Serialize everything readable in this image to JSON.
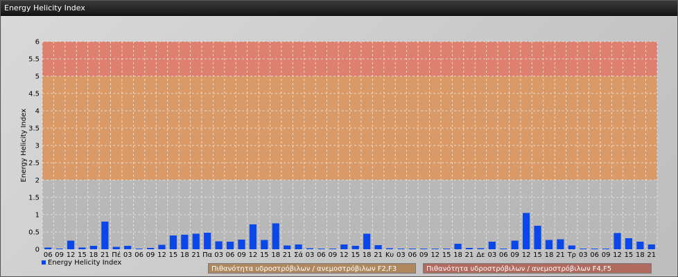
{
  "window": {
    "title": "Energy Helicity Index"
  },
  "legend": {
    "series_label": "Energy Helicity Index",
    "band1_label": "Πιθανότητα υδροστρόβιλων / ανεμοστρόβιλων F2,F3",
    "band2_label": "Πιθανότητα υδροστρόβιλων / ανεμοστρόβιλων F4,F5"
  },
  "colors": {
    "bar": "#0a47e6",
    "band_low": "#b8b8b8",
    "band_mid": "#d99a68",
    "band_high": "#de8070",
    "band1_legend": "#b08860",
    "band2_legend": "#b06a5e"
  },
  "chart_data": {
    "type": "bar",
    "ylabel": "Energy Helicity Index",
    "ylim": [
      0,
      6
    ],
    "yticks": [
      "0",
      "0.5",
      "1",
      "1.5",
      "2",
      "2.5",
      "3",
      "3.5",
      "4",
      "4.5",
      "5",
      "5.5",
      "6"
    ],
    "bands": [
      {
        "from": 0,
        "to": 2,
        "color": "#b8b8b8"
      },
      {
        "from": 2,
        "to": 5,
        "color": "#d99a68"
      },
      {
        "from": 5,
        "to": 6,
        "color": "#de8070"
      }
    ],
    "grid": true,
    "legend_position": "bottom-left",
    "categories": [
      "06",
      "09",
      "12",
      "15",
      "18",
      "21",
      "Πέ",
      "03",
      "06",
      "09",
      "12",
      "15",
      "18",
      "21",
      "Πα",
      "03",
      "06",
      "09",
      "12",
      "15",
      "18",
      "21",
      "Σά",
      "03",
      "06",
      "09",
      "12",
      "15",
      "18",
      "21",
      "Κυ",
      "03",
      "06",
      "09",
      "12",
      "15",
      "18",
      "21",
      "Δε",
      "03",
      "06",
      "09",
      "12",
      "15",
      "18",
      "21",
      "Τρ",
      "03",
      "06",
      "09",
      "12",
      "15",
      "18",
      "21"
    ],
    "series": [
      {
        "name": "Energy Helicity Index",
        "values": [
          0.05,
          0.02,
          0.25,
          0.05,
          0.1,
          0.8,
          0.07,
          0.1,
          0.02,
          0.04,
          0.13,
          0.4,
          0.42,
          0.45,
          0.48,
          0.23,
          0.22,
          0.28,
          0.72,
          0.27,
          0.75,
          0.11,
          0.14,
          0.03,
          0.02,
          0.02,
          0.14,
          0.1,
          0.45,
          0.12,
          0.03,
          0.02,
          0.02,
          0.02,
          0.02,
          0.02,
          0.16,
          0.04,
          0.03,
          0.22,
          0.02,
          0.25,
          1.05,
          0.68,
          0.27,
          0.29,
          0.11,
          0.02,
          0.02,
          0.02,
          0.47,
          0.32,
          0.22,
          0.14
        ]
      }
    ]
  }
}
